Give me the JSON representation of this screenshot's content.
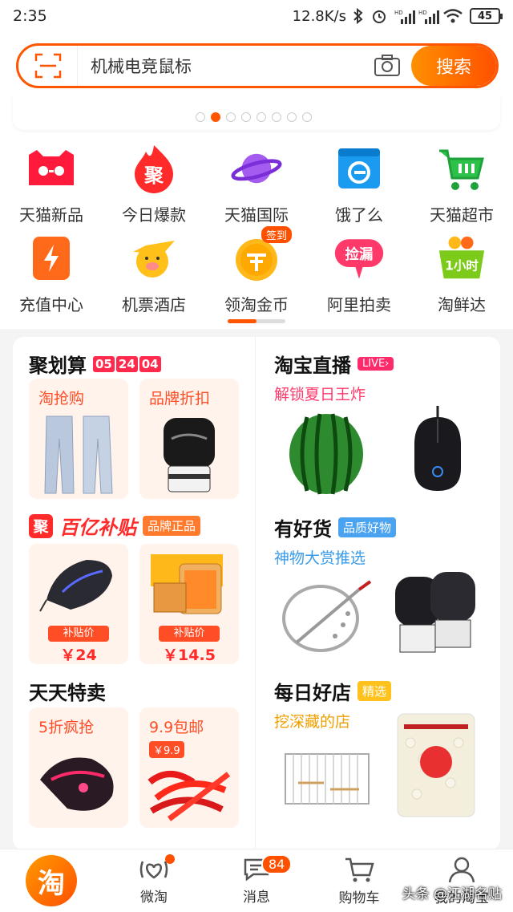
{
  "status": {
    "time": "2:35",
    "speed": "12.8K/s",
    "hd1": "HD",
    "hd2": "HD",
    "battery": "45"
  },
  "search": {
    "placeholder": "机械电竞鼠标",
    "button": "搜索"
  },
  "carousel": {
    "total": 8,
    "active": 2
  },
  "grid": [
    [
      {
        "label": "天猫新品",
        "icon": "tmall-cat-icon"
      },
      {
        "label": "今日爆款",
        "icon": "ju-flame-icon",
        "glyph": "聚"
      },
      {
        "label": "天猫国际",
        "icon": "planet-icon"
      },
      {
        "label": "饿了么",
        "icon": "eleme-icon"
      },
      {
        "label": "天猫超市",
        "icon": "cart-icon"
      }
    ],
    [
      {
        "label": "充值中心",
        "icon": "phone-charge-icon"
      },
      {
        "label": "机票酒店",
        "icon": "fly-pig-icon"
      },
      {
        "label": "领淘金币",
        "icon": "coin-icon",
        "badge": "签到"
      },
      {
        "label": "阿里拍卖",
        "icon": "auction-icon",
        "glyph": "捡漏"
      },
      {
        "label": "淘鲜达",
        "icon": "basket-icon",
        "glyph": "1小时"
      }
    ]
  ],
  "juhuasuan": {
    "title": "聚划算",
    "countdown": [
      "05",
      "24",
      "04"
    ],
    "tiles": [
      {
        "label": "淘抢购"
      },
      {
        "label": "品牌折扣"
      }
    ]
  },
  "subsidy": {
    "logo_char": "聚",
    "title": "百亿补贴",
    "tag": "品牌正品",
    "tiles": [
      {
        "price_label": "补贴价",
        "price": "￥24"
      },
      {
        "price_label": "补贴价",
        "price": "￥14.5"
      }
    ]
  },
  "tiantian": {
    "title": "天天特卖",
    "tiles": [
      {
        "label": "5折疯抢"
      },
      {
        "label": "9.9包邮",
        "mini_price": "￥9.9"
      }
    ]
  },
  "live": {
    "title": "淘宝直播",
    "tag": "LIVE›",
    "subtitle": "解锁夏日王炸"
  },
  "haohuo": {
    "title": "有好货",
    "tag": "品质好物",
    "subtitle": "神物大赏推选"
  },
  "dailyshop": {
    "title": "每日好店",
    "tag": "精选",
    "subtitle": "挖深藏的店"
  },
  "tabbar": [
    {
      "label": "淘",
      "type": "home"
    },
    {
      "label": "微淘",
      "dot": true
    },
    {
      "label": "消息",
      "badge": "84"
    },
    {
      "label": "购物车"
    },
    {
      "label": "我的淘宝"
    }
  ],
  "watermark": "头条 @江湖名贴"
}
